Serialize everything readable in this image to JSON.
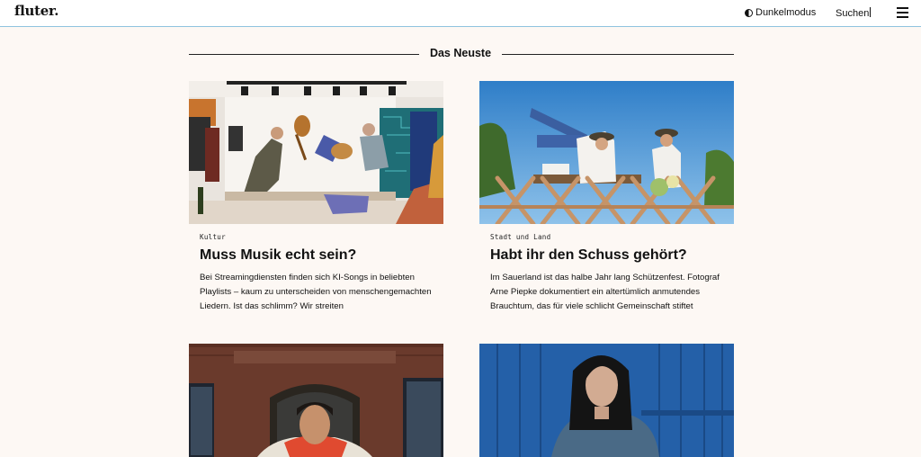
{
  "header": {
    "logo": "fluter.",
    "darkmode_label": "Dunkelmodus",
    "search_label": "Suchen"
  },
  "section": {
    "title": "Das Neuste"
  },
  "articles": [
    {
      "category": "Kultur",
      "title": "Muss Musik echt sein?",
      "description": "Bei Streamingdiensten finden sich KI-Songs in beliebten Playlists – kaum zu unterscheiden von menschengemachten Liedern. Ist das schlimm? Wir streiten"
    },
    {
      "category": "Stadt und Land",
      "title": "Habt ihr den Schuss gehört?",
      "description": "Im Sauerland ist das halbe Jahr lang Schützenfest. Fotograf Arne Piepke dokumentiert ein altertümlich anmutendes Brauchtum, das für viele schlicht Gemeinschaft stiftet"
    }
  ],
  "colors": {
    "page_background": "#fdf8f4",
    "header_border": "#8fc3df",
    "text": "#111111"
  }
}
